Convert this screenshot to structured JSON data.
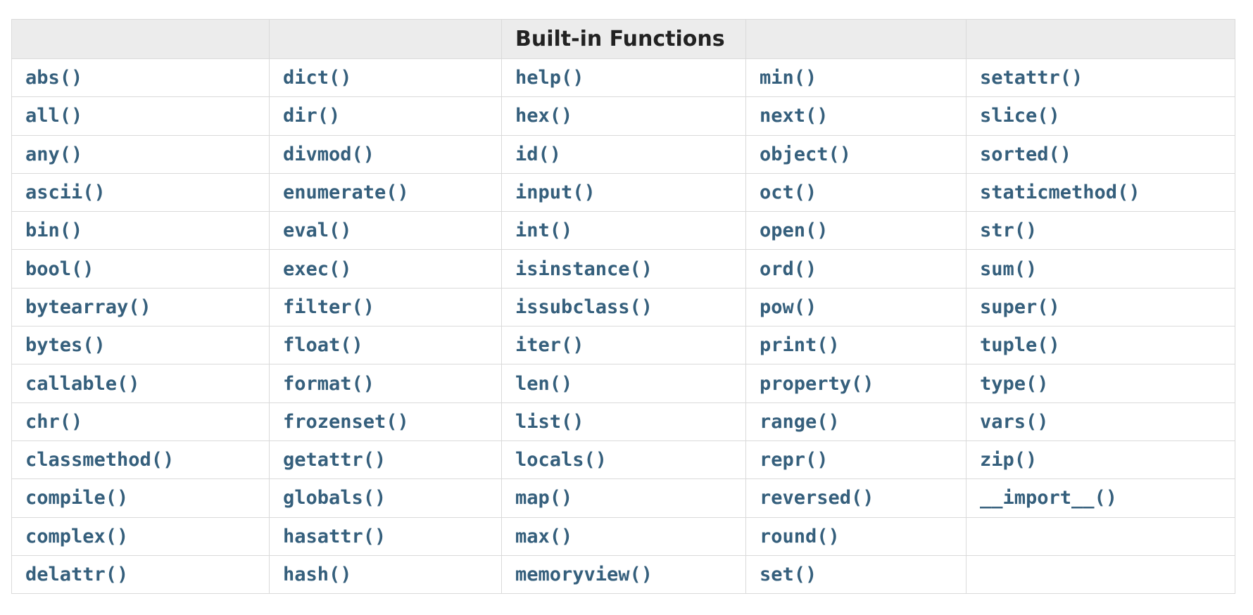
{
  "table": {
    "header": [
      "",
      "",
      "Built-in Functions",
      "",
      ""
    ],
    "rows": [
      [
        "abs()",
        "dict()",
        "help()",
        "min()",
        "setattr()"
      ],
      [
        "all()",
        "dir()",
        "hex()",
        "next()",
        "slice()"
      ],
      [
        "any()",
        "divmod()",
        "id()",
        "object()",
        "sorted()"
      ],
      [
        "ascii()",
        "enumerate()",
        "input()",
        "oct()",
        "staticmethod()"
      ],
      [
        "bin()",
        "eval()",
        "int()",
        "open()",
        "str()"
      ],
      [
        "bool()",
        "exec()",
        "isinstance()",
        "ord()",
        "sum()"
      ],
      [
        "bytearray()",
        "filter()",
        "issubclass()",
        "pow()",
        "super()"
      ],
      [
        "bytes()",
        "float()",
        "iter()",
        "print()",
        "tuple()"
      ],
      [
        "callable()",
        "format()",
        "len()",
        "property()",
        "type()"
      ],
      [
        "chr()",
        "frozenset()",
        "list()",
        "range()",
        "vars()"
      ],
      [
        "classmethod()",
        "getattr()",
        "locals()",
        "repr()",
        "zip()"
      ],
      [
        "compile()",
        "globals()",
        "map()",
        "reversed()",
        "__import__()"
      ],
      [
        "complex()",
        "hasattr()",
        "max()",
        "round()",
        ""
      ],
      [
        "delattr()",
        "hash()",
        "memoryview()",
        "set()",
        ""
      ]
    ]
  },
  "colors": {
    "link": "#355f7c",
    "header_bg": "#ececec",
    "border": "#dadada",
    "header_text": "#222222"
  }
}
